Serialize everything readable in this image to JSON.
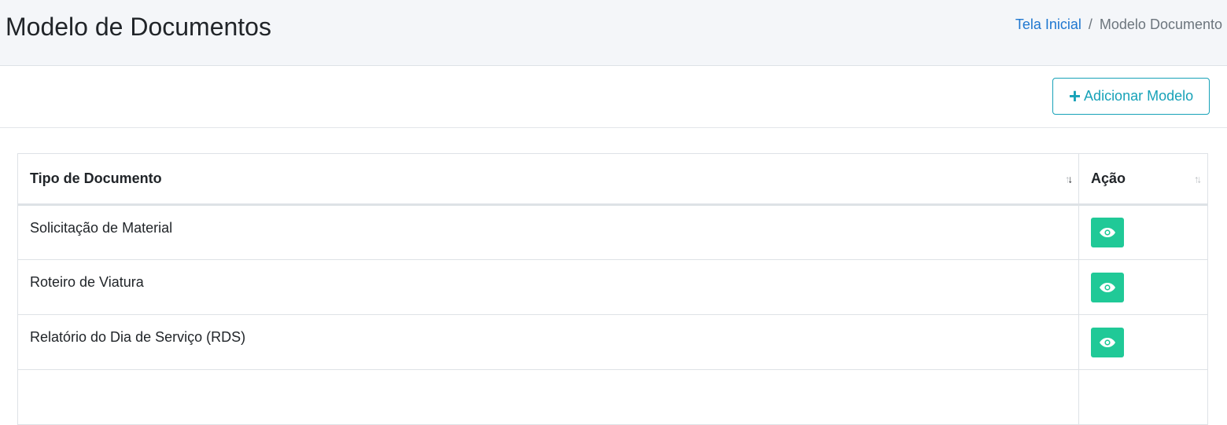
{
  "header": {
    "title": "Modelo de Documentos",
    "breadcrumb": {
      "home": "Tela Inicial",
      "separator": "/",
      "current": "Modelo Documento"
    }
  },
  "toolbar": {
    "add_icon": "plus-icon",
    "add_label": "Adicionar Modelo",
    "accent_color": "#17a2b8"
  },
  "table": {
    "columns": [
      {
        "label": "Tipo de Documento",
        "sort": "desc"
      },
      {
        "label": "Ação",
        "sort": "none"
      }
    ],
    "rows": [
      {
        "tipo": "Solicitação de Material",
        "action_icon": "eye-icon"
      },
      {
        "tipo": "Roteiro de Viatura",
        "action_icon": "eye-icon"
      },
      {
        "tipo": "Relatório do Dia de Serviço (RDS)",
        "action_icon": "eye-icon"
      }
    ],
    "action_color": "#20c997"
  }
}
